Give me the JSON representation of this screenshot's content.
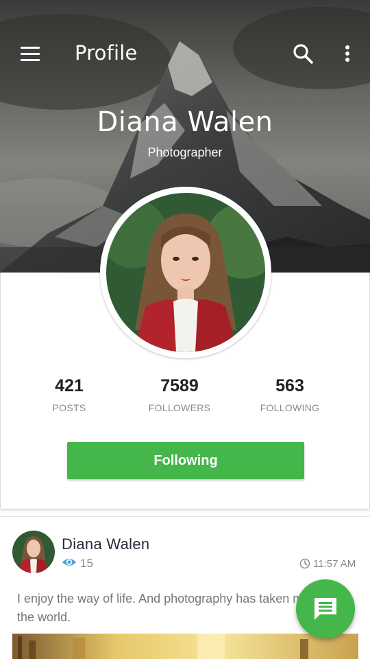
{
  "appbar": {
    "title": "Profile",
    "menu_icon": "hamburger-menu-icon",
    "search_icon": "search-icon",
    "more_icon": "more-vertical-icon"
  },
  "profile": {
    "name": "Diana Walen",
    "role": "Photographer",
    "avatar": "profile-photo-avatar"
  },
  "stats": [
    {
      "value": "421",
      "label": "POSTS"
    },
    {
      "value": "7589",
      "label": "FOLLOWERS"
    },
    {
      "value": "563",
      "label": "FOLLOWING"
    }
  ],
  "follow_button": {
    "label": "Following"
  },
  "post": {
    "author": "Diana Walen",
    "views": "15",
    "time": "11:57 AM",
    "text": "I enjoy the way of life. And photography has taken me around the world.",
    "view_icon": "eye-icon",
    "time_icon": "clock-icon"
  },
  "fab": {
    "icon": "chat-message-icon"
  },
  "colors": {
    "accent_green": "#45b649",
    "eye_blue": "#4a9fdc",
    "text_dark": "#222222",
    "text_muted": "#8a8a8a"
  }
}
